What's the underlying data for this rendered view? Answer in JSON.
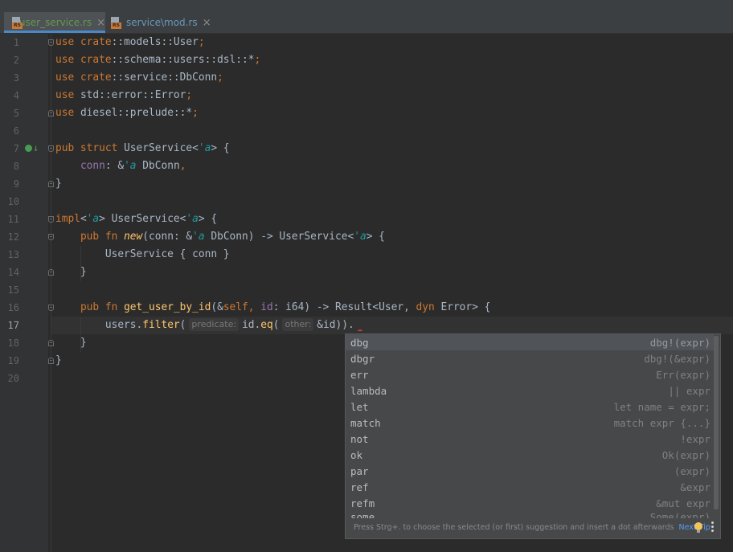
{
  "tabs": [
    {
      "label": "user_service.rs",
      "close": "×",
      "icon": "rust-file-icon"
    },
    {
      "label": "service\\mod.rs",
      "close": "×",
      "icon": "rust-file-icon"
    }
  ],
  "file_icon_text": "RS",
  "line_numbers": [
    "1",
    "2",
    "3",
    "4",
    "5",
    "6",
    "7",
    "8",
    "9",
    "10",
    "11",
    "12",
    "13",
    "14",
    "15",
    "16",
    "17",
    "18",
    "19",
    "20"
  ],
  "current_line": "17",
  "code": {
    "l1": [
      "use ",
      "crate",
      "::models::User",
      ";"
    ],
    "l2": [
      "use ",
      "crate",
      "::schema::users::dsl::*",
      ";"
    ],
    "l3": [
      "use ",
      "crate",
      "::service::DbConn",
      ";"
    ],
    "l4": [
      "use ",
      "std::error::Error",
      ";"
    ],
    "l5": [
      "use ",
      "diesel::prelude::*",
      ";"
    ],
    "l7": [
      "pub struct ",
      "UserService<",
      "'a",
      "> {"
    ],
    "l8": [
      "    ",
      "conn",
      ": &",
      "'a",
      " DbConn",
      ","
    ],
    "l9": [
      "}"
    ],
    "l11": [
      "impl",
      "<",
      "'a",
      "> UserService<",
      "'a",
      "> {"
    ],
    "l12": [
      "    ",
      "pub fn ",
      "new",
      "(conn: &",
      "'a",
      " DbConn) -> UserService<",
      "'a",
      "> {"
    ],
    "l13": [
      "        UserService { conn }"
    ],
    "l14": [
      "    }"
    ],
    "l16": [
      "    ",
      "pub fn ",
      "get_user_by_id",
      "(&",
      "self",
      ", ",
      "id",
      ": i64) -> Result<User, ",
      "dyn ",
      "Error> {"
    ],
    "l17": [
      "        users.",
      "filter",
      "(",
      "predicate:",
      "id.",
      "eq",
      "(",
      "other:",
      "&id))."
    ],
    "l18": [
      "    }"
    ],
    "l19": [
      "}"
    ]
  },
  "completion": {
    "items": [
      {
        "name": "dbg",
        "tail": "dbg!(expr)"
      },
      {
        "name": "dbgr",
        "tail": "dbg!(&expr)"
      },
      {
        "name": "err",
        "tail": "Err(expr)"
      },
      {
        "name": "lambda",
        "tail": "|| expr"
      },
      {
        "name": "let",
        "tail": "let name = expr;"
      },
      {
        "name": "match",
        "tail": "match expr {...}"
      },
      {
        "name": "not",
        "tail": "!expr"
      },
      {
        "name": "ok",
        "tail": "Ok(expr)"
      },
      {
        "name": "par",
        "tail": "(expr)"
      },
      {
        "name": "ref",
        "tail": "&expr"
      },
      {
        "name": "refm",
        "tail": "&mut expr"
      },
      {
        "name": "some",
        "tail": "Some(expr)"
      }
    ],
    "selected_index": 0,
    "footer_text": "Press Strg+. to choose the selected (or first) suggestion and insert a dot afterwards",
    "next_tip": "Next Tip"
  },
  "colors": {
    "keyword": "#cc7832",
    "lifetime": "#20999d",
    "field": "#9876aa",
    "function": "#ffc66d",
    "text": "#a9b7c6"
  }
}
